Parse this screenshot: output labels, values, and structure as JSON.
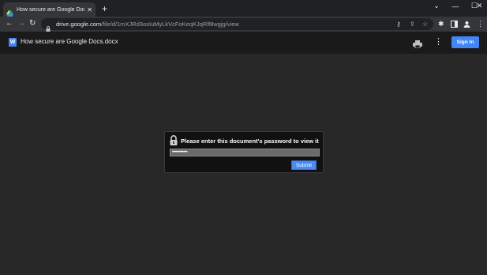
{
  "browser": {
    "tab": {
      "title": "How secure are Google Docs.docx",
      "close": "✕"
    },
    "new_tab": "+",
    "window_controls": {
      "minimize": "—",
      "maximize": "☐",
      "close": "✕",
      "dropdown": "⌄"
    },
    "nav": {
      "back": "←",
      "forward": "→",
      "reload": "↻"
    },
    "address": {
      "host": "drive.google.com",
      "path": "/file/d/1mXJRd3osIuMyLkVcFoKeqKJqRlf8wgjg/view"
    },
    "icons": [
      "key-icon",
      "share-icon",
      "star-icon",
      "extensions-icon",
      "sidepanel-icon",
      "profile-icon",
      "menu-icon"
    ]
  },
  "viewer": {
    "doc_title": "How secure are Google Docs.docx",
    "doc_icon_letter": "W",
    "sign_in_label": "Sign In",
    "more_icon": "⋮"
  },
  "dialog": {
    "message": "Please enter this document's password to view it",
    "password_value": "••••••••••••",
    "submit_label": "Submit"
  },
  "colors": {
    "accent": "#4285f4",
    "background": "#282828",
    "dialog_bg": "#111111"
  }
}
